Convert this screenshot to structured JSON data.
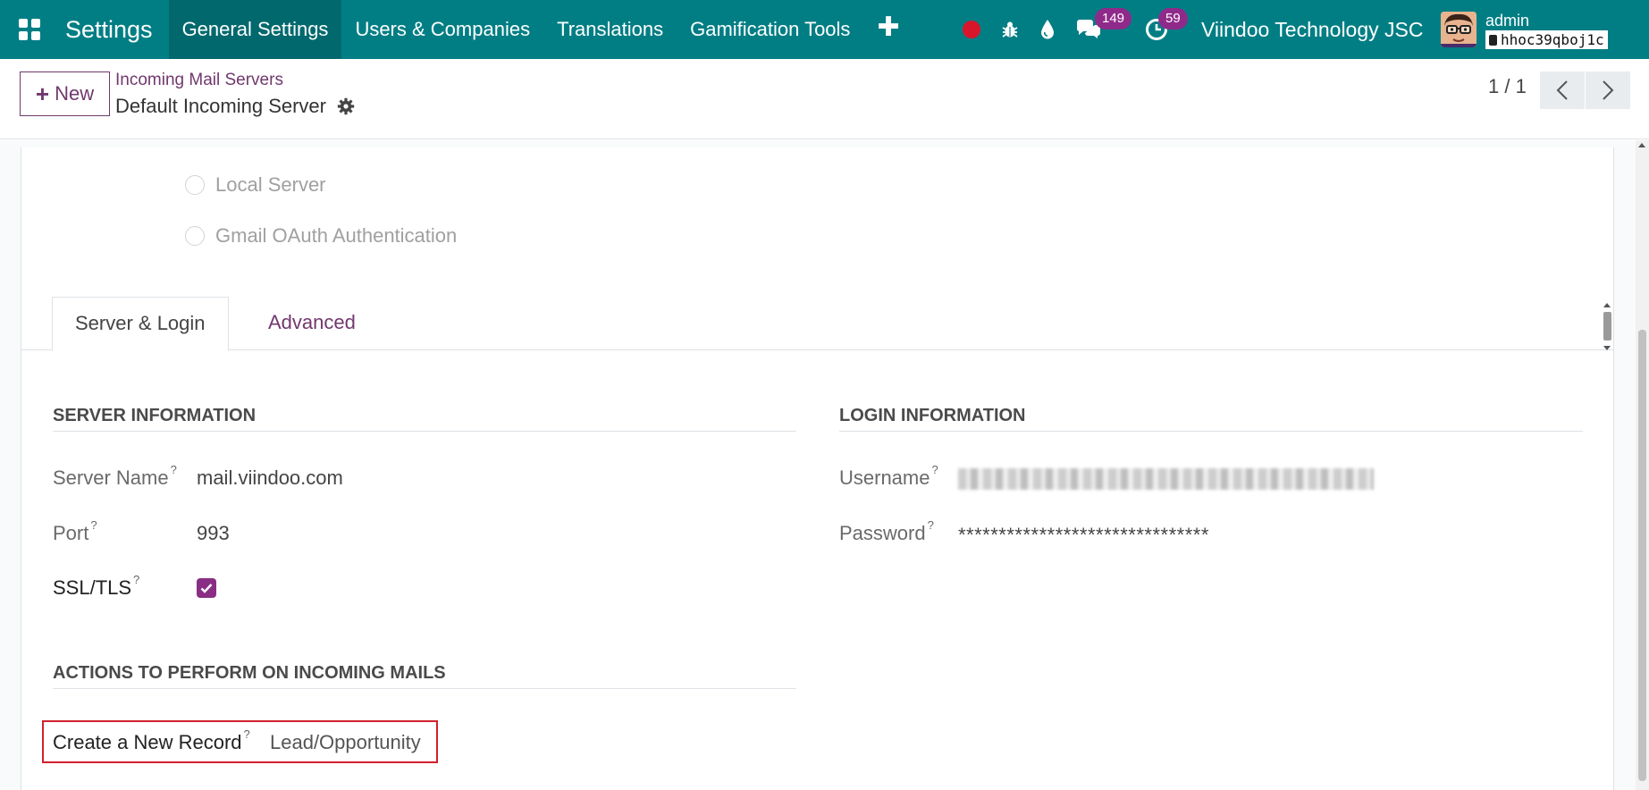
{
  "navbar": {
    "app_name": "Settings",
    "menu": [
      {
        "label": "General Settings"
      },
      {
        "label": "Users & Companies"
      },
      {
        "label": "Translations"
      },
      {
        "label": "Gamification Tools"
      }
    ],
    "plus_label": "✚",
    "messages_count": "149",
    "activities_count": "59",
    "company": "Viindoo Technology JSC",
    "user_name": "admin",
    "database": "hhoc39qboj1c",
    "icons": [
      "apps-grid-icon",
      "record-dot-icon",
      "bug-icon",
      "drop-icon",
      "chat-icon",
      "clock-icon"
    ]
  },
  "control_panel": {
    "new_label": "New",
    "breadcrumb": "Incoming Mail Servers",
    "record_title": "Default Incoming Server",
    "pager": "1 / 1"
  },
  "form": {
    "server_types": [
      {
        "label": "Local Server"
      },
      {
        "label": "Gmail OAuth Authentication"
      }
    ],
    "tabs": [
      {
        "label": "Server & Login",
        "active": true
      },
      {
        "label": "Advanced",
        "active": false
      }
    ],
    "server_info": {
      "title": "Server Information",
      "server_name_label": "Server Name",
      "server_name_value": "mail.viindoo.com",
      "port_label": "Port",
      "port_value": "993",
      "ssl_label": "SSL/TLS",
      "ssl_checked": true
    },
    "login_info": {
      "title": "Login Information",
      "username_label": "Username",
      "password_label": "Password",
      "password_value": "*******************************"
    },
    "actions": {
      "title": "Actions to Perform on Incoming Mails",
      "create_record_label": "Create a New Record",
      "create_record_value": "Lead/Opportunity"
    },
    "help_mark": "?"
  },
  "colors": {
    "navbar": "#017e84",
    "accent": "#71386e",
    "checkbox": "#8a2e85",
    "highlight": "#d21f2d"
  }
}
